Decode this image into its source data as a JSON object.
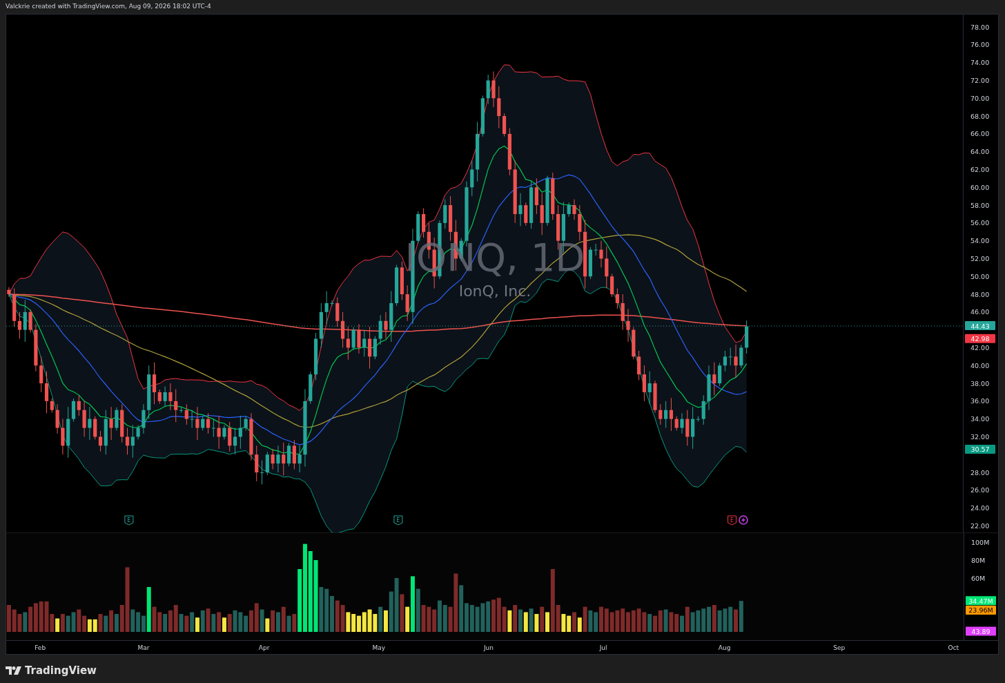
{
  "header": {
    "text": "Valckrie created with TradingView.com, Aug 09, 2026 18:02 UTC-4"
  },
  "price_pane": {
    "watermark": {
      "symbol": "IONQ, 1D",
      "name": "IonQ, Inc."
    },
    "axis_labels": [
      "78.00",
      "76.00",
      "74.00",
      "72.00",
      "70.00",
      "68.00",
      "66.00",
      "64.00",
      "62.00",
      "60.00",
      "58.00",
      "56.00",
      "54.00",
      "52.00",
      "50.00",
      "48.00",
      "46.00",
      "42.00",
      "40.00",
      "38.00",
      "36.00",
      "34.00",
      "32.00",
      "28.00",
      "26.00",
      "24.00",
      "22.00"
    ],
    "badges": [
      {
        "label": "44.43",
        "color": "#26a69a"
      },
      {
        "label": "42.98",
        "color": "#f23645"
      },
      {
        "label": "30.57",
        "color": "#089981"
      }
    ],
    "events": [
      {
        "kind": "earnings",
        "label": "E",
        "color": "#26a69a"
      },
      {
        "kind": "earnings",
        "label": "E",
        "color": "#26a69a"
      },
      {
        "kind": "earnings",
        "label": "E",
        "color": "#f23645"
      },
      {
        "kind": "lightning",
        "color": "#c040e0"
      }
    ]
  },
  "volume_pane": {
    "axis_labels": [
      "100M",
      "80M",
      "60M"
    ],
    "badges": [
      {
        "label": "34.47M",
        "color": "#00e676"
      },
      {
        "label": "23.96M",
        "color": "#ff9800"
      },
      {
        "label": "43.89",
        "color": "#e040fb"
      }
    ]
  },
  "time_axis": [
    "Feb",
    "Mar",
    "Apr",
    "May",
    "Jun",
    "Jul",
    "Aug",
    "Sep",
    "Oct"
  ],
  "footer": {
    "brand": "TradingView"
  }
}
